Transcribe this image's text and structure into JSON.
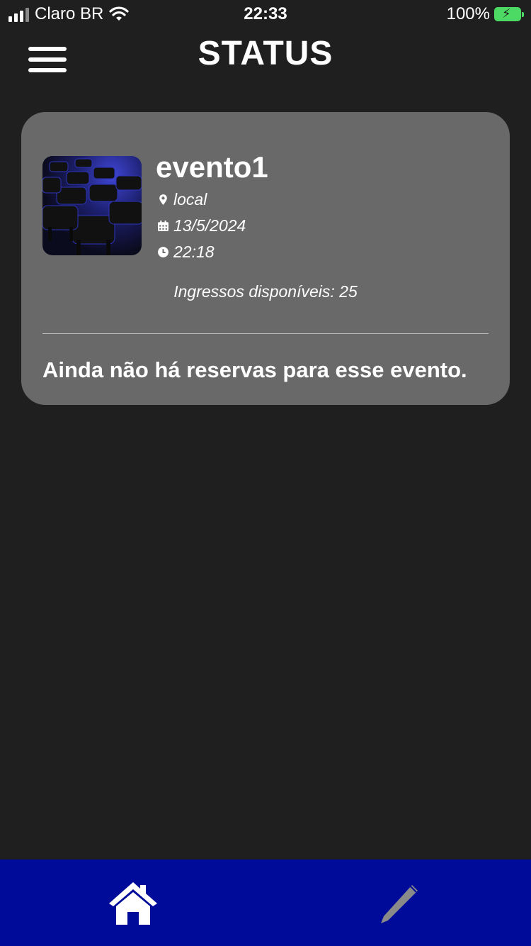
{
  "status_bar": {
    "carrier": "Claro BR",
    "time": "22:33",
    "battery": "100%"
  },
  "header": {
    "title": "STATUS",
    "menu_icon": "hamburger-menu-icon"
  },
  "event": {
    "name": "evento1",
    "location": "local",
    "date": "13/5/2024",
    "time": "22:18",
    "tickets_available": "Ingressos disponíveis: 25",
    "no_reservations": "Ainda não há reservas para esse evento."
  },
  "bottom_nav": {
    "items": [
      {
        "name": "home",
        "icon": "home-icon",
        "active": true
      },
      {
        "name": "edit",
        "icon": "pencil-icon",
        "active": false
      }
    ]
  },
  "colors": {
    "background": "#1f1f1f",
    "card": "#6a6969",
    "nav_bar": "#000c99",
    "battery": "#4cd964",
    "inactive_icon": "#8a8a8a"
  }
}
